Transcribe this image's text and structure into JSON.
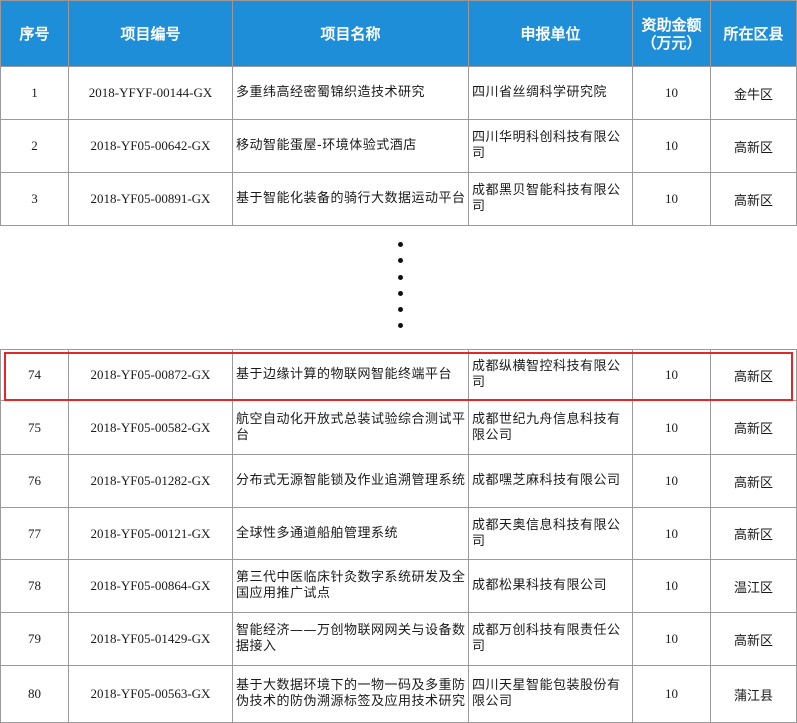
{
  "headers": {
    "seq": "序号",
    "code": "项目编号",
    "name": "项目名称",
    "unit": "申报单位",
    "amount_line1": "资助金额",
    "amount_line2": "（万元）",
    "district": "所在区县"
  },
  "rows_top": [
    {
      "seq": "1",
      "code": "2018-YFYF-00144-GX",
      "name": "多重纬高经密蜀锦织造技术研究",
      "unit": "四川省丝绸科学研究院",
      "amount": "10",
      "district": "金牛区"
    },
    {
      "seq": "2",
      "code": "2018-YF05-00642-GX",
      "name": "移动智能蛋屋-环境体验式酒店",
      "unit": "四川华明科创科技有限公司",
      "amount": "10",
      "district": "高新区"
    },
    {
      "seq": "3",
      "code": "2018-YF05-00891-GX",
      "name": "基于智能化装备的骑行大数据运动平台",
      "unit": "成都黑贝智能科技有限公司",
      "amount": "10",
      "district": "高新区"
    }
  ],
  "rows_bottom": [
    {
      "seq": "74",
      "code": "2018-YF05-00872-GX",
      "name": "基于边缘计算的物联网智能终端平台",
      "unit": "成都纵横智控科技有限公司",
      "amount": "10",
      "district": "高新区"
    },
    {
      "seq": "75",
      "code": "2018-YF05-00582-GX",
      "name": "航空自动化开放式总装试验综合测试平台",
      "unit": "成都世纪九舟信息科技有限公司",
      "amount": "10",
      "district": "高新区"
    },
    {
      "seq": "76",
      "code": "2018-YF05-01282-GX",
      "name": "分布式无源智能锁及作业追溯管理系统",
      "unit": "成都嘿芝麻科技有限公司",
      "amount": "10",
      "district": "高新区"
    },
    {
      "seq": "77",
      "code": "2018-YF05-00121-GX",
      "name": "全球性多通道船舶管理系统",
      "unit": "成都天奥信息科技有限公司",
      "amount": "10",
      "district": "高新区"
    },
    {
      "seq": "78",
      "code": "2018-YF05-00864-GX",
      "name": "第三代中医临床针灸数字系统研发及全国应用推广试点",
      "unit": "成都松果科技有限公司",
      "amount": "10",
      "district": "温江区"
    },
    {
      "seq": "79",
      "code": "2018-YF05-01429-GX",
      "name": "智能经济——万创物联网网关与设备数据接入",
      "unit": "成都万创科技有限责任公司",
      "amount": "10",
      "district": "高新区"
    },
    {
      "seq": "80",
      "code": "2018-YF05-00563-GX",
      "name": "基于大数据环境下的一物一码及多重防伪技术的防伪溯源标签及应用技术研究",
      "unit": "四川天星智能包装股份有限公司",
      "amount": "10",
      "district": "蒲江县"
    }
  ]
}
